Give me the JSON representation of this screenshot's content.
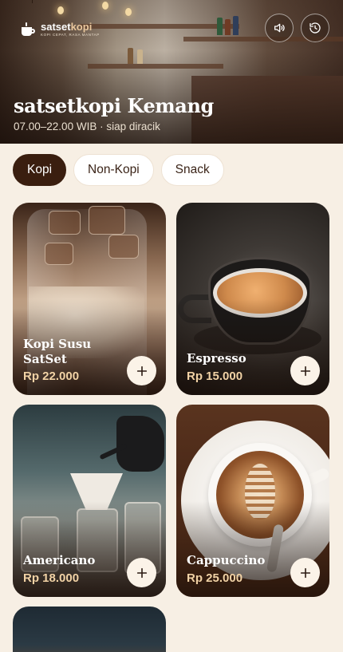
{
  "brand": {
    "name_part1": "satset",
    "name_part2": "kopi",
    "tagline": "KOPI CEPAT, RASA MANTAP"
  },
  "header": {
    "shop_name": "satsetkopi Kemang",
    "hours": "07.00–22.00 WIB · siap diracik",
    "sound_icon": "speaker-icon",
    "history_icon": "history-icon"
  },
  "tabs": [
    {
      "label": "Kopi",
      "active": true
    },
    {
      "label": "Non-Kopi",
      "active": false
    },
    {
      "label": "Snack",
      "active": false
    }
  ],
  "products": [
    {
      "name": "Kopi Susu SatSet",
      "price": "Rp 22.000"
    },
    {
      "name": "Espresso",
      "price": "Rp 15.000"
    },
    {
      "name": "Americano",
      "price": "Rp 18.000"
    },
    {
      "name": "Cappuccino",
      "price": "Rp 25.000"
    }
  ],
  "colors": {
    "background": "#f7efe4",
    "primary": "#3a1e0f",
    "price_accent": "#f1d2a5"
  }
}
